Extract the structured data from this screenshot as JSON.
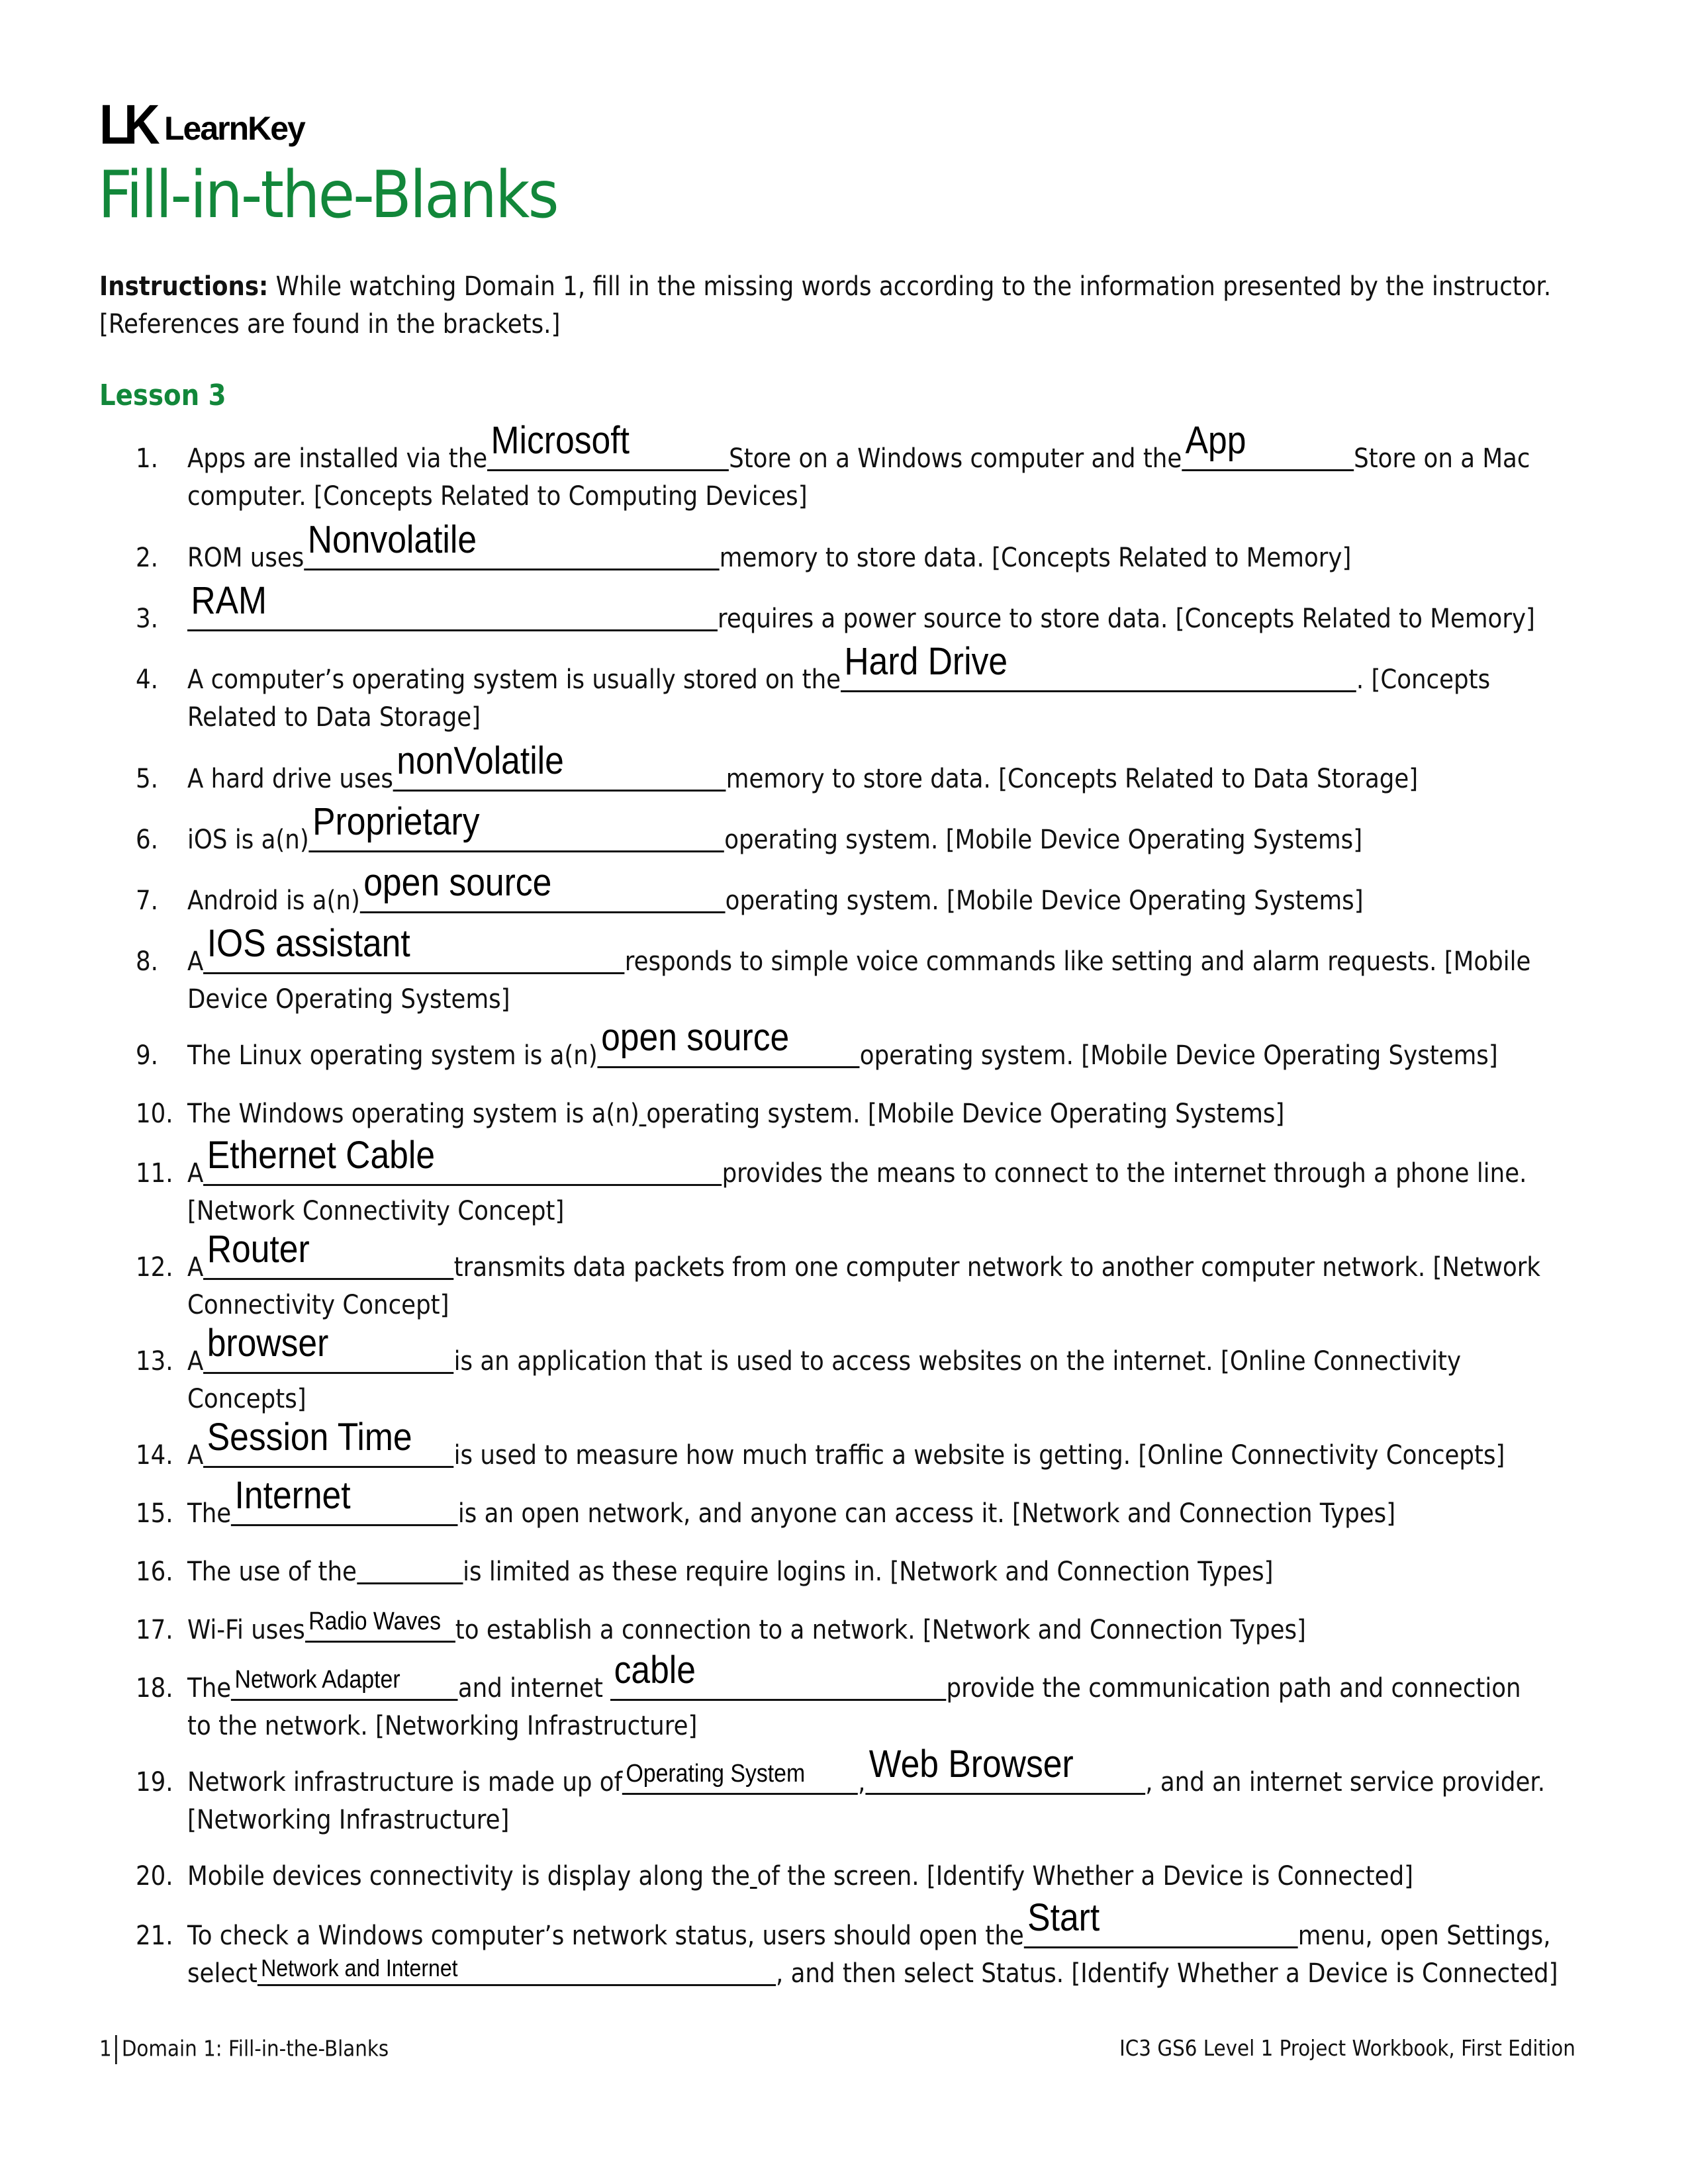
{
  "header": {
    "logo_mark": "LK",
    "logo_text": "LearnKey",
    "title": "Fill-in-the-Blanks"
  },
  "instructions": {
    "label": "Instructions:",
    "text": " While watching Domain 1, fill in the missing words according to the information presented by the instructor.",
    "text2": "[References are found in the brackets.]"
  },
  "lesson": "Lesson 3",
  "colors": {
    "accent": "#12873a",
    "text": "#111111"
  },
  "items": [
    {
      "num": "1.",
      "a": "Apps are installed via the",
      "ans1": "Microsoft",
      "b": "Store on a Windows computer and the",
      "ans2": "App",
      "c": "Store on a Mac",
      "d": "computer. [Concepts Related to Computing Devices]"
    },
    {
      "num": "2.",
      "a": "ROM uses",
      "ans1": "Nonvolatile",
      "b": "memory to store data. [Concepts Related to Memory]"
    },
    {
      "num": "3.",
      "ans1": "RAM",
      "b": "requires a power source to store data. [Concepts Related to Memory]"
    },
    {
      "num": "4.",
      "a": "A computer’s operating system is usually stored on the",
      "ans1": "Hard Drive",
      "b": ". [Concepts",
      "d": "Related to Data Storage]"
    },
    {
      "num": "5.",
      "a": "A hard drive uses",
      "ans1": "nonVolatile",
      "b": "memory to store data. [Concepts Related to Data Storage]"
    },
    {
      "num": "6.",
      "a": "iOS is a(n)",
      "ans1": "Proprietary",
      "b": "operating system. [Mobile Device Operating Systems]"
    },
    {
      "num": "7.",
      "a": "Android is a(n)",
      "ans1": "open source",
      "b": "operating system. [Mobile Device Operating Systems]"
    },
    {
      "num": "8.",
      "a": "A",
      "ans1": "IOS assistant",
      "b": "responds to simple voice commands like setting and alarm requests. [Mobile",
      "d": "Device Operating Systems]"
    },
    {
      "num": "9.",
      "a": "The Linux operating system is a(n)",
      "ans1": "open source",
      "b": "operating system. [Mobile Device Operating Systems]"
    },
    {
      "num": "10.",
      "a": "The Windows operating system is a(n)",
      "ans1": "",
      "b": "operating system. [Mobile Device Operating Systems]"
    },
    {
      "num": "11.",
      "a": "A",
      "ans1": "Ethernet Cable",
      "b": "provides the means to connect to the internet through a phone line.",
      "d": "[Network Connectivity Concept]"
    },
    {
      "num": "12.",
      "a": "A",
      "ans1": "Router",
      "b": "transmits data packets from one computer network to another computer network. [Network",
      "d": "Connectivity Concept]"
    },
    {
      "num": "13.",
      "a": "A",
      "ans1": "browser",
      "b": "is an application that is used to access websites on the internet. [Online Connectivity",
      "d": "Concepts]"
    },
    {
      "num": "14.",
      "a": "A",
      "ans1": "Session Time",
      "b": "is used to measure how much traffic a website is getting. [Online Connectivity Concepts]"
    },
    {
      "num": "15.",
      "a": "The",
      "ans1": "Internet",
      "b": "is an open network, and anyone can access it. [Network and Connection Types]"
    },
    {
      "num": "16.",
      "a": "The use of the",
      "ans1": "",
      "b": "is limited as these require logins in. [Network and Connection Types]"
    },
    {
      "num": "17.",
      "a": "Wi-Fi uses",
      "ans1": "Radio Waves",
      "b": "to establish a connection to a network. [Network and Connection Types]"
    },
    {
      "num": "18.",
      "a": "The",
      "ans1": "Network Adapter",
      "b": "and internet ",
      "ans2": "cable",
      "c": "provide the communication path and connection",
      "d": "to the network. [Networking Infrastructure]"
    },
    {
      "num": "19.",
      "a": "Network infrastructure is made up of",
      "ans1": "Operating System",
      "b": ",",
      "ans2": "Web Browser",
      "c": ", and an internet service provider.",
      "d": "[Networking Infrastructure]"
    },
    {
      "num": "20.",
      "a": "Mobile devices connectivity is display along the",
      "ans1": "",
      "b": "of the screen. [Identify Whether a Device is Connected]"
    },
    {
      "num": "21.",
      "a": "To check a Windows computer’s network status, users should open the",
      "ans1": "Start",
      "b": "menu, open Settings,",
      "e": "select",
      "ans2": "Network and Internet",
      "c": ", and then select Status. [Identify Whether a Device is Connected]"
    }
  ],
  "footer": {
    "page": "1",
    "left": "Domain 1: Fill-in-the-Blanks",
    "right": "IC3 GS6 Level 1 Project Workbook, First Edition"
  }
}
